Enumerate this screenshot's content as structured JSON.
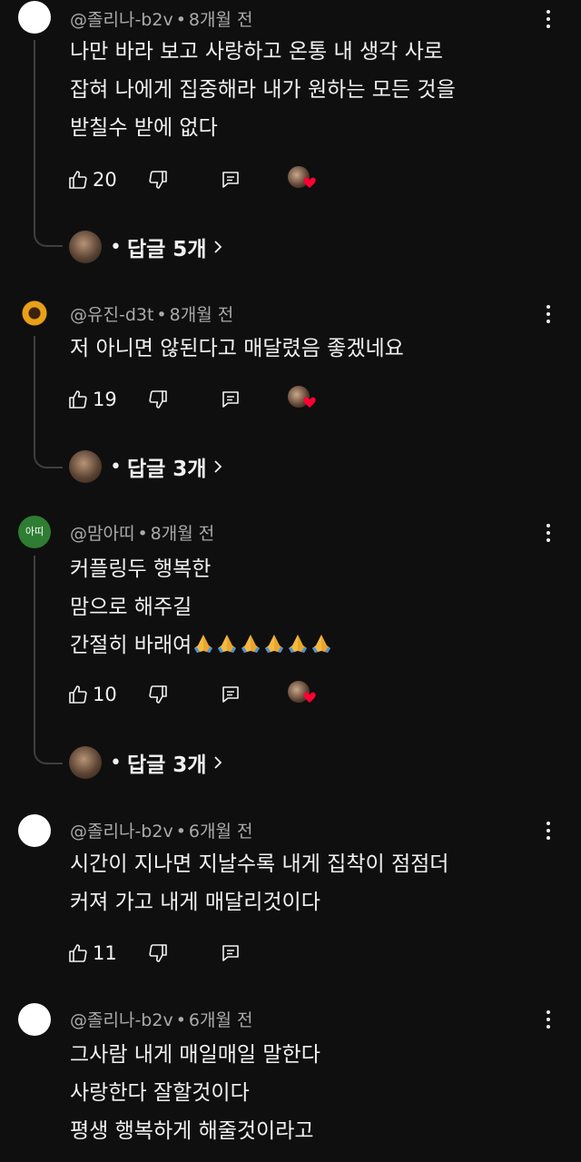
{
  "comments": [
    {
      "author": "@졸리나-b2v",
      "time": "8개월 전",
      "lines": [
        "나만 바라 보고 사랑하고  온통 내 생각 사로",
        "잡혀 나에게 집중해라 내가 원하는 모든 것을",
        "받칠수 받에 없다"
      ],
      "likes": "20",
      "replies_label": "답글 5개"
    },
    {
      "author": "@유진-d3t",
      "time": "8개월 전",
      "lines": [
        "저 아니면 않된다고 매달렸음 좋겠네요"
      ],
      "likes": "19",
      "replies_label": "답글 3개"
    },
    {
      "author": "@맘아띠",
      "avatar_text": "아띠",
      "time": "8개월 전",
      "lines": [
        "커플링두  행복한",
        "맘으로  해주길",
        "간절히  바래여"
      ],
      "emoji": "🙏🙏🙏🙏🙏🙏",
      "likes": "10",
      "replies_label": "답글 3개"
    },
    {
      "author": "@졸리나-b2v",
      "time": "6개월 전",
      "lines": [
        "시간이 지나면 지날수록 내게 집착이 점점더",
        "커져 가고 내게 매달리것이다"
      ],
      "likes": "11"
    },
    {
      "author": "@졸리나-b2v",
      "time": "6개월 전",
      "lines": [
        "그사람 내게 매일매일 말한다",
        "사랑한다 잘할것이다",
        "평생 행복하게 해줄것이라고"
      ]
    }
  ],
  "meta_separator": "•",
  "replies_dot": "•",
  "icons": {
    "like": "thumbs-up-icon",
    "dislike": "thumbs-down-icon",
    "reply": "reply-icon",
    "menu": "more-vert-icon",
    "heart": "creator-heart-icon",
    "chevron": "chevron-right-icon"
  },
  "colors": {
    "background": "#0f0f0f",
    "text": "#f1f1f1",
    "secondary_text": "#aaaaaa",
    "heart": "#ff0033",
    "avatar_green": "#2e7d32"
  }
}
